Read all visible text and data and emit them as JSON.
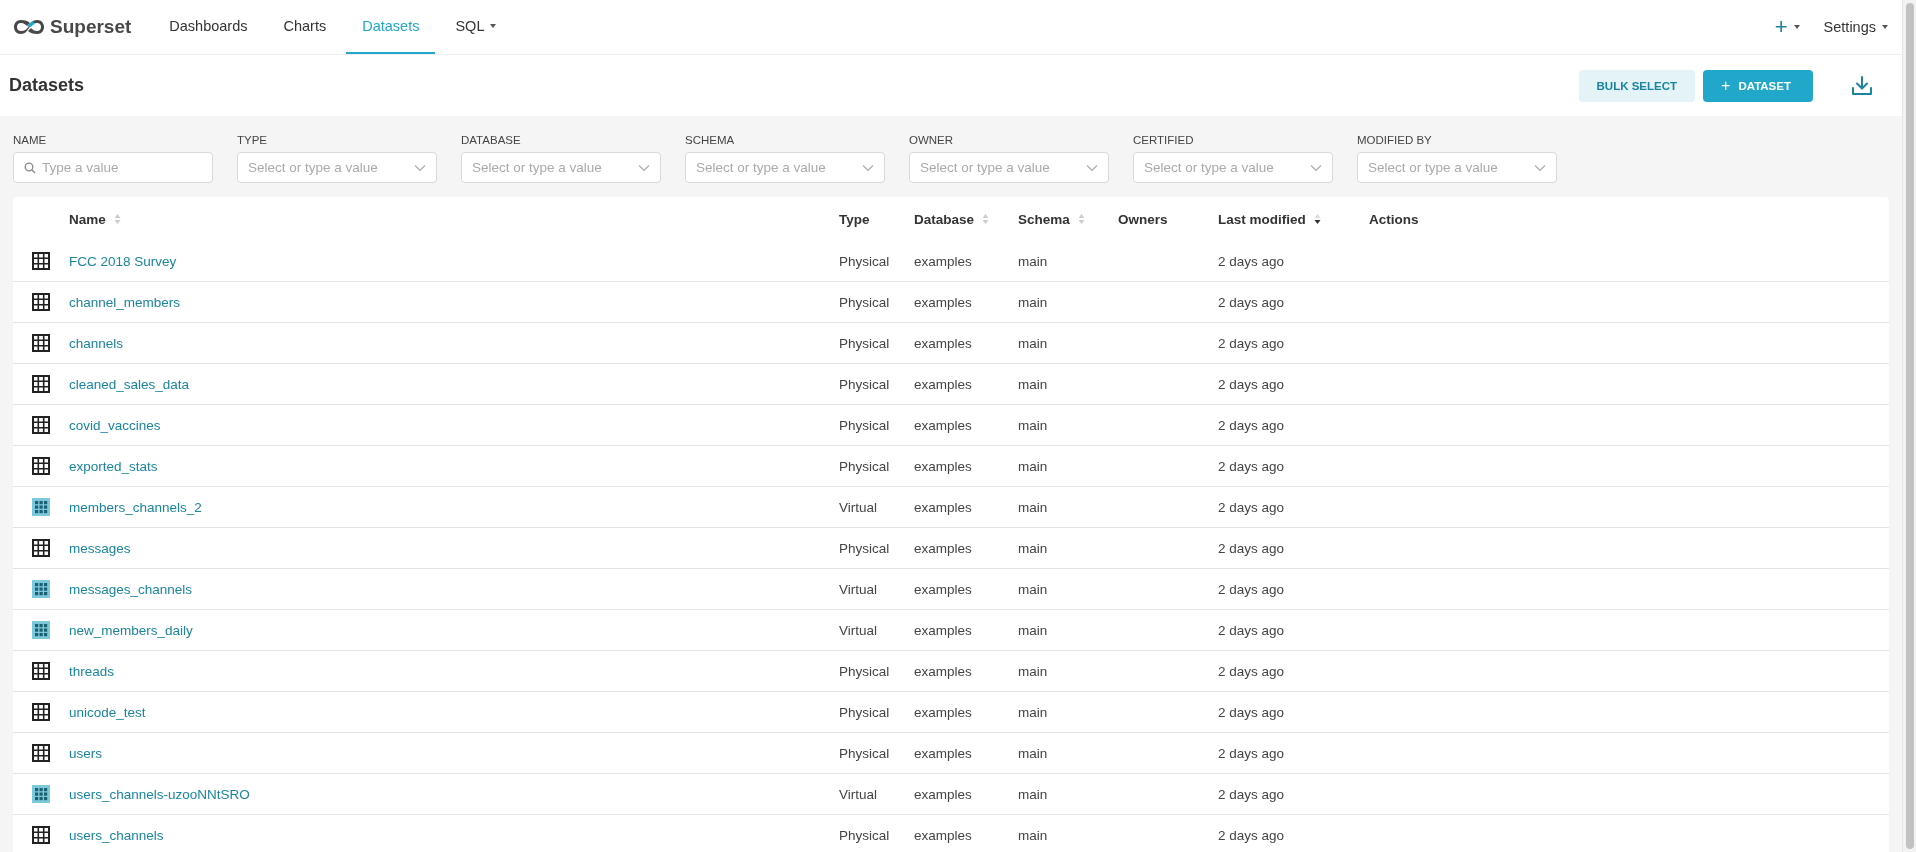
{
  "nav": {
    "brand": "Superset",
    "items": [
      {
        "label": "Dashboards",
        "selected": false,
        "dropdown": false
      },
      {
        "label": "Charts",
        "selected": false,
        "dropdown": false
      },
      {
        "label": "Datasets",
        "selected": true,
        "dropdown": false
      },
      {
        "label": "SQL",
        "selected": false,
        "dropdown": true
      }
    ],
    "right": [
      {
        "kind": "plus",
        "label": "+"
      },
      {
        "kind": "text",
        "label": "Settings"
      }
    ]
  },
  "header": {
    "title": "Datasets",
    "bulk_select": "BULK SELECT",
    "add_button": {
      "icon": "+",
      "label": "DATASET"
    }
  },
  "filters": [
    {
      "label": "NAME",
      "kind": "search",
      "placeholder": "Type a value"
    },
    {
      "label": "TYPE",
      "kind": "select",
      "placeholder": "Select or type a value"
    },
    {
      "label": "DATABASE",
      "kind": "select",
      "placeholder": "Select or type a value"
    },
    {
      "label": "SCHEMA",
      "kind": "select",
      "placeholder": "Select or type a value"
    },
    {
      "label": "OWNER",
      "kind": "select",
      "placeholder": "Select or type a value"
    },
    {
      "label": "CERTIFIED",
      "kind": "select",
      "placeholder": "Select or type a value"
    },
    {
      "label": "MODIFIED BY",
      "kind": "select",
      "placeholder": "Select or type a value"
    }
  ],
  "table": {
    "columns": [
      {
        "label": "Name",
        "sortable": true,
        "sorted": false
      },
      {
        "label": "Type",
        "sortable": false,
        "sorted": false
      },
      {
        "label": "Database",
        "sortable": true,
        "sorted": false
      },
      {
        "label": "Schema",
        "sortable": true,
        "sorted": false
      },
      {
        "label": "Owners",
        "sortable": false,
        "sorted": false
      },
      {
        "label": "Last modified",
        "sortable": true,
        "sorted": true
      },
      {
        "label": "Actions",
        "sortable": false,
        "sorted": false
      }
    ],
    "rows": [
      {
        "kind": "physical",
        "name": "FCC 2018 Survey",
        "type": "Physical",
        "database": "examples",
        "schema": "main",
        "modified": "2 days ago"
      },
      {
        "kind": "physical",
        "name": "channel_members",
        "type": "Physical",
        "database": "examples",
        "schema": "main",
        "modified": "2 days ago"
      },
      {
        "kind": "physical",
        "name": "channels",
        "type": "Physical",
        "database": "examples",
        "schema": "main",
        "modified": "2 days ago"
      },
      {
        "kind": "physical",
        "name": "cleaned_sales_data",
        "type": "Physical",
        "database": "examples",
        "schema": "main",
        "modified": "2 days ago"
      },
      {
        "kind": "physical",
        "name": "covid_vaccines",
        "type": "Physical",
        "database": "examples",
        "schema": "main",
        "modified": "2 days ago"
      },
      {
        "kind": "physical",
        "name": "exported_stats",
        "type": "Physical",
        "database": "examples",
        "schema": "main",
        "modified": "2 days ago"
      },
      {
        "kind": "virtual",
        "name": "members_channels_2",
        "type": "Virtual",
        "database": "examples",
        "schema": "main",
        "modified": "2 days ago"
      },
      {
        "kind": "physical",
        "name": "messages",
        "type": "Physical",
        "database": "examples",
        "schema": "main",
        "modified": "2 days ago"
      },
      {
        "kind": "virtual",
        "name": "messages_channels",
        "type": "Virtual",
        "database": "examples",
        "schema": "main",
        "modified": "2 days ago"
      },
      {
        "kind": "virtual",
        "name": "new_members_daily",
        "type": "Virtual",
        "database": "examples",
        "schema": "main",
        "modified": "2 days ago"
      },
      {
        "kind": "physical",
        "name": "threads",
        "type": "Physical",
        "database": "examples",
        "schema": "main",
        "modified": "2 days ago"
      },
      {
        "kind": "physical",
        "name": "unicode_test",
        "type": "Physical",
        "database": "examples",
        "schema": "main",
        "modified": "2 days ago"
      },
      {
        "kind": "physical",
        "name": "users",
        "type": "Physical",
        "database": "examples",
        "schema": "main",
        "modified": "2 days ago"
      },
      {
        "kind": "virtual",
        "name": "users_channels-uzooNNtSRO",
        "type": "Virtual",
        "database": "examples",
        "schema": "main",
        "modified": "2 days ago"
      },
      {
        "kind": "physical",
        "name": "users_channels",
        "type": "Physical",
        "database": "examples",
        "schema": "main",
        "modified": "2 days ago"
      }
    ]
  }
}
